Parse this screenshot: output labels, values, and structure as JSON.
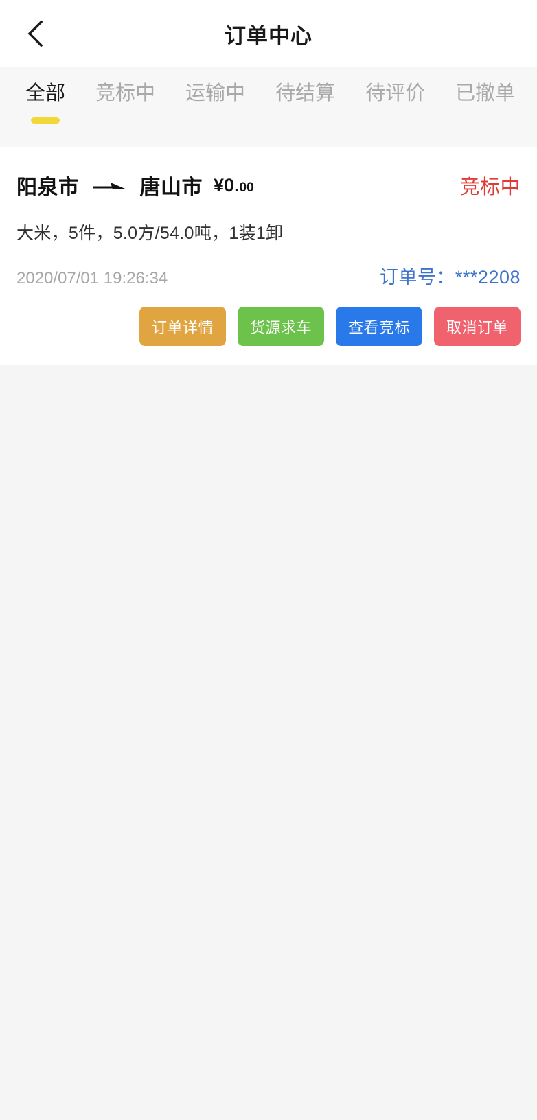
{
  "header": {
    "title": "订单中心",
    "back_icon": "chevron-left-icon"
  },
  "tabs": [
    {
      "label": "全部",
      "active": true
    },
    {
      "label": "竞标中",
      "active": false
    },
    {
      "label": "运输中",
      "active": false
    },
    {
      "label": "待结算",
      "active": false
    },
    {
      "label": "待评价",
      "active": false
    },
    {
      "label": "已撤单",
      "active": false
    }
  ],
  "order": {
    "origin": "阳泉市",
    "route_icon": "arrow-right-icon",
    "destination": "唐山市",
    "price_main": "¥0.",
    "price_decimals": "00",
    "status": "竞标中",
    "cargo": "大米，5件，5.0方/54.0吨，1装1卸",
    "timestamp": "2020/07/01 19:26:34",
    "order_number": "订单号：***2208",
    "actions": [
      {
        "label": "订单详情",
        "style": "btn-detail"
      },
      {
        "label": "货源求车",
        "style": "btn-truck"
      },
      {
        "label": "查看竞标",
        "style": "btn-bid"
      },
      {
        "label": "取消订单",
        "style": "btn-cancel"
      }
    ]
  },
  "colors": {
    "accent_yellow": "#f3d638",
    "status_red": "#e03a36",
    "order_blue": "#3f74cb",
    "btn_orange": "#e0a440",
    "btn_green": "#6dc24c",
    "btn_blue": "#2a79ea",
    "btn_red": "#f0626d",
    "page_bg": "#f5f5f5",
    "tabbar_bg": "#f7f7f7"
  }
}
